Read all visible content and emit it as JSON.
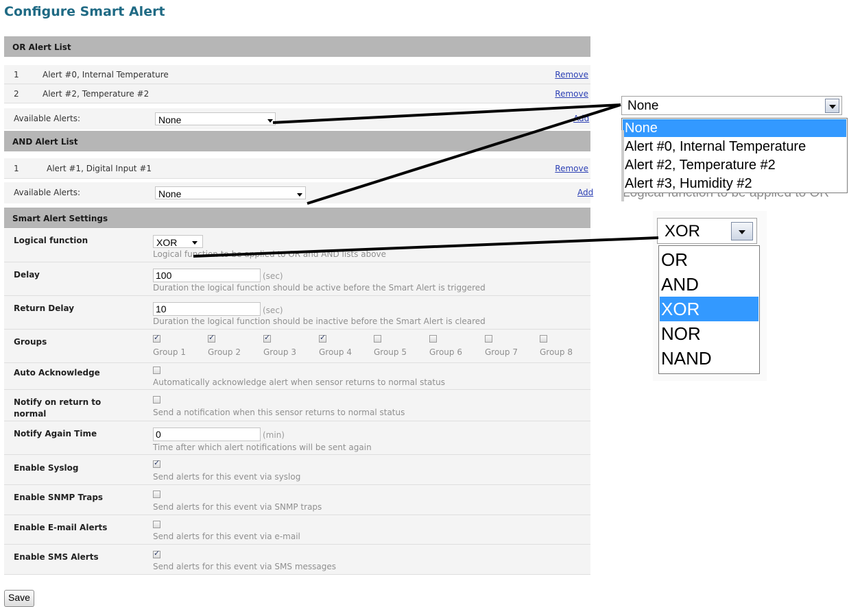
{
  "page_title": "Configure Smart Alert",
  "or_list": {
    "header": "OR Alert List",
    "items": [
      {
        "index": "1",
        "name": "Alert #0, Internal Temperature",
        "action": "Remove"
      },
      {
        "index": "2",
        "name": "Alert #2, Temperature #2",
        "action": "Remove"
      }
    ],
    "available_label": "Available Alerts:",
    "available_value": "None",
    "add_label": "Add"
  },
  "and_list": {
    "header": "AND Alert List",
    "items": [
      {
        "index": "1",
        "name": "Alert #1, Digital Input #1",
        "action": "Remove"
      }
    ],
    "available_label": "Available Alerts:",
    "available_value": "None",
    "add_label": "Add"
  },
  "settings": {
    "header": "Smart Alert Settings",
    "logical_function": {
      "label": "Logical function",
      "value": "XOR",
      "hint": "Logical function to be applied to OR and AND lists above"
    },
    "delay": {
      "label": "Delay",
      "value": "100",
      "unit": "(sec)",
      "hint": "Duration the logical function should be active before the Smart Alert is triggered"
    },
    "return_delay": {
      "label": "Return Delay",
      "value": "10",
      "unit": "(sec)",
      "hint": "Duration the logical function should be inactive before the Smart Alert is cleared"
    },
    "groups": {
      "label": "Groups",
      "items": [
        {
          "name": "Group 1",
          "checked": true
        },
        {
          "name": "Group 2",
          "checked": true
        },
        {
          "name": "Group 3",
          "checked": true
        },
        {
          "name": "Group 4",
          "checked": true
        },
        {
          "name": "Group 5",
          "checked": false
        },
        {
          "name": "Group 6",
          "checked": false
        },
        {
          "name": "Group 7",
          "checked": false
        },
        {
          "name": "Group 8",
          "checked": false
        }
      ]
    },
    "auto_ack": {
      "label": "Auto Acknowledge",
      "checked": false,
      "hint": "Automatically acknowledge alert when sensor returns to normal status"
    },
    "notify_return": {
      "label_line1": "Notify on return to",
      "label_line2": "normal",
      "checked": false,
      "hint": "Send a notification when this sensor returns to normal status"
    },
    "notify_again": {
      "label": "Notify Again Time",
      "value": "0",
      "unit": "(min)",
      "hint": "Time after which alert notifications will be sent again"
    },
    "syslog": {
      "label": "Enable Syslog",
      "checked": true,
      "hint": "Send alerts for this event via syslog"
    },
    "snmp": {
      "label": "Enable SNMP Traps",
      "checked": false,
      "hint": "Send alerts for this event via SNMP traps"
    },
    "email": {
      "label": "Enable E-mail Alerts",
      "checked": false,
      "hint": "Send alerts for this event via e-mail"
    },
    "sms": {
      "label": "Enable SMS Alerts",
      "checked": true,
      "hint": "Send alerts for this event via SMS messages"
    }
  },
  "save_label": "Save",
  "callout_alerts": {
    "selected": "None",
    "options": [
      "None",
      "Alert #0, Internal Temperature",
      "Alert #2, Temperature #2",
      "Alert #3, Humidity #2"
    ],
    "highlighted": "None",
    "background_text": "Logical function to be applied to OR"
  },
  "callout_logic": {
    "selected": "XOR",
    "options": [
      "OR",
      "AND",
      "XOR",
      "NOR",
      "NAND"
    ],
    "highlighted": "XOR"
  },
  "colors": {
    "section_header": "#b6b6b6",
    "title": "#1f6a84",
    "highlight": "#3399ff",
    "link": "#2b3fb4"
  }
}
